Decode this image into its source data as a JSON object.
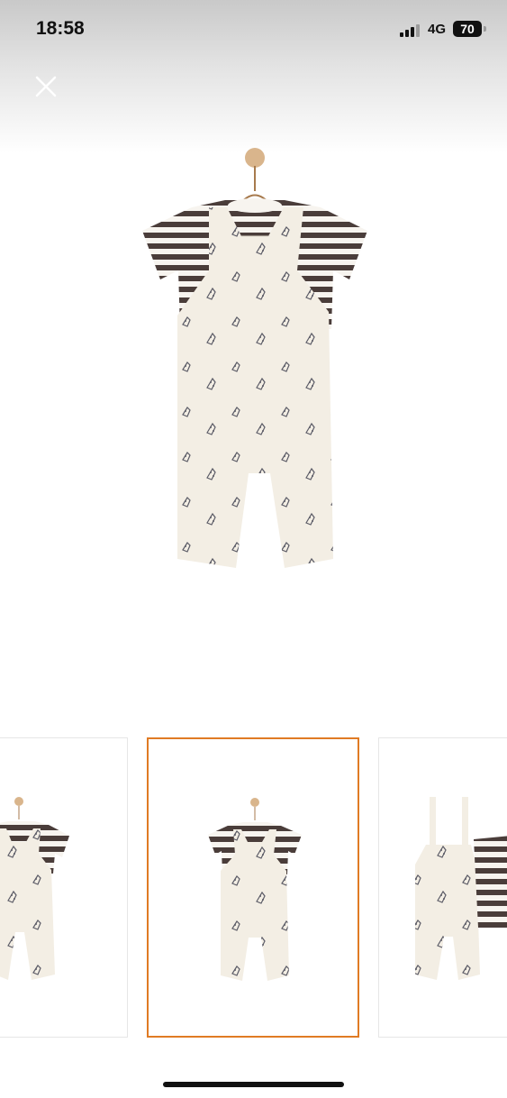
{
  "status_bar": {
    "time": "18:58",
    "network": "4G",
    "battery": "70"
  },
  "close_button": {
    "icon": "close-icon"
  },
  "product_image": {
    "description_icon": "product-photo"
  },
  "gallery": {
    "accent_color": "#e07b24",
    "selected_index": 1,
    "thumbnails": [
      {
        "name": "thumbnail-1"
      },
      {
        "name": "thumbnail-2"
      },
      {
        "name": "thumbnail-3"
      }
    ]
  }
}
